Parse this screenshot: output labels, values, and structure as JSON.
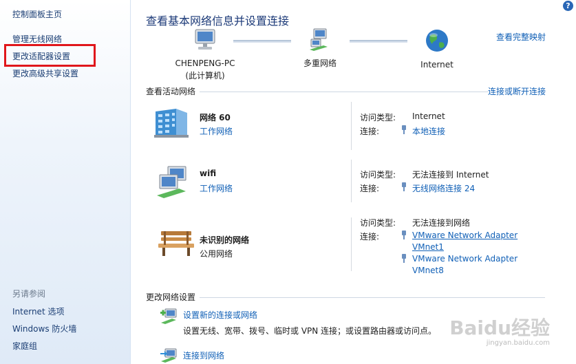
{
  "sidebar": {
    "home": "控制面板主页",
    "items": [
      "管理无线网络",
      "更改适配器设置",
      "更改高级共享设置"
    ],
    "see_also_title": "另请参阅",
    "see_also": [
      "Internet 选项",
      "Windows 防火墙",
      "家庭组"
    ]
  },
  "help_label": "?",
  "main": {
    "title": "查看基本网络信息并设置连接",
    "map_link": "查看完整映射",
    "nodes": [
      {
        "label": "CHENPENG-PC",
        "sub": "(此计算机)"
      },
      {
        "label": "多重网络"
      },
      {
        "label": "Internet"
      }
    ],
    "active_title": "查看活动网络",
    "connect_link": "连接或断开连接",
    "networks": [
      {
        "name": "网络  60",
        "type": "工作网络",
        "access_label": "访问类型:",
        "access": "Internet",
        "conn_label": "连接:",
        "connections": [
          "本地连接"
        ]
      },
      {
        "name": "wifi",
        "type": "工作网络",
        "access_label": "访问类型:",
        "access": "无法连接到 Internet",
        "conn_label": "连接:",
        "connections": [
          "无线网络连接 24"
        ]
      },
      {
        "name": "未识别的网络",
        "type": "公用网络",
        "access_label": "访问类型:",
        "access": "无法连接到网络",
        "conn_label": "连接:",
        "connections": [
          "VMware Network Adapter",
          "VMnet1",
          "VMware Network Adapter",
          "VMnet8"
        ]
      }
    ],
    "change_title": "更改网络设置",
    "tasks": [
      {
        "title": "设置新的连接或网络",
        "desc": "设置无线、宽带、拨号、临时或 VPN 连接；或设置路由器或访问点。"
      },
      {
        "title": "连接到网络"
      }
    ]
  },
  "watermark": {
    "brand": "Baidu经验",
    "url": "jingyan.baidu.com"
  },
  "colors": {
    "link": "#0f5fb6",
    "title": "#1c3a78",
    "highlight": "#e0161b"
  }
}
